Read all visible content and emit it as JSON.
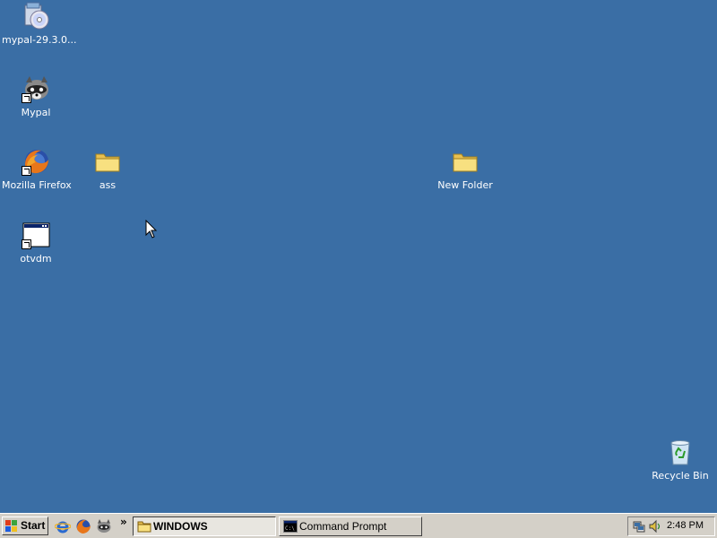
{
  "desktop": {
    "icons": [
      {
        "label": "mypal-29.3.0...",
        "icon": "installer-cd-icon"
      },
      {
        "label": "Mypal",
        "icon": "mypal-raccoon-icon"
      },
      {
        "label": "Mozilla Firefox",
        "icon": "firefox-icon"
      },
      {
        "label": "otvdm",
        "icon": "application-window-icon"
      },
      {
        "label": "ass",
        "icon": "folder-icon"
      },
      {
        "label": "New Folder",
        "icon": "folder-icon"
      },
      {
        "label": "Recycle Bin",
        "icon": "recycle-bin-icon"
      }
    ],
    "background_color": "#3a6ea5"
  },
  "taskbar": {
    "start_label": "Start",
    "quick_launch": [
      "internet-explorer-icon",
      "firefox-icon",
      "mypal-raccoon-icon"
    ],
    "overflow_label": "»",
    "tasks": [
      {
        "label": "WINDOWS",
        "icon": "folder-icon",
        "active": true
      },
      {
        "label": "Command Prompt",
        "icon": "command-prompt-icon",
        "active": false
      }
    ],
    "tray_icons": [
      "network-icon",
      "speaker-icon"
    ],
    "clock": "2:48 PM"
  }
}
